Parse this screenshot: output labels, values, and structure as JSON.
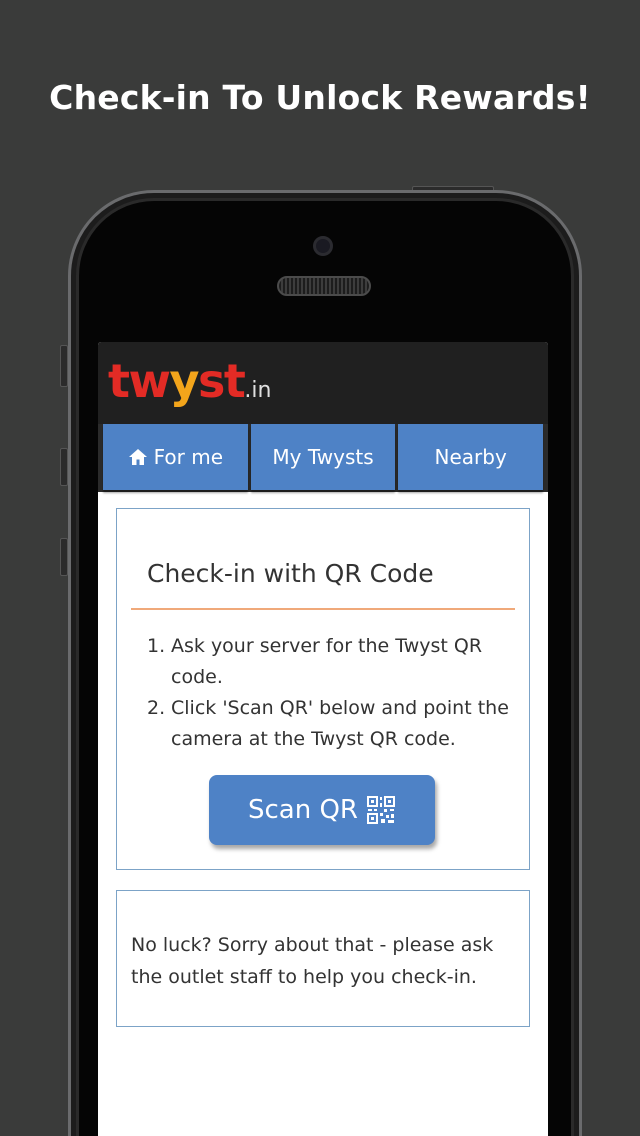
{
  "headline": "Check-in To Unlock Rewards!",
  "logo": {
    "main_pre": "tw",
    "main_y": "y",
    "main_post": "st",
    "suffix": ".in"
  },
  "tabs": [
    {
      "label": "For me",
      "icon": "home-icon"
    },
    {
      "label": "My Twysts"
    },
    {
      "label": "Nearby"
    }
  ],
  "checkin_card": {
    "title": "Check-in with QR Code",
    "steps": [
      {
        "num": "1.",
        "text": "Ask your server for the Twyst QR code."
      },
      {
        "num": "2.",
        "text": "Click 'Scan QR' below and point the camera at the Twyst QR code."
      }
    ],
    "scan_button": {
      "label": "Scan QR",
      "icon": "qr-code-icon"
    }
  },
  "help_card": {
    "text": "No luck? Sorry about that - please ask the outlet staff to help you check-in."
  },
  "colors": {
    "accent": "#4e82c6",
    "brand_red": "#e32b25",
    "brand_orange": "#f3a51b",
    "divider": "#f0a97a"
  }
}
